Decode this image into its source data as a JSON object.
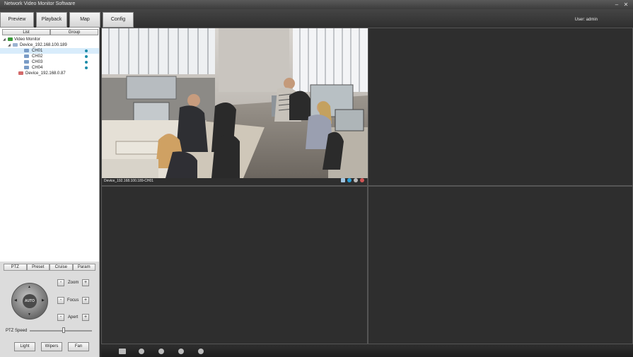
{
  "window": {
    "title": "Network Video Monitor Software"
  },
  "tabs": [
    "Preview",
    "Playback",
    "Map",
    "Config"
  ],
  "user": "User: admin",
  "left": {
    "tabs": [
      "List",
      "Group"
    ],
    "tree": {
      "root": "Video Monitor",
      "device1": "Device_192.168.100.189",
      "channels": [
        "CH01",
        "CH02",
        "CH03",
        "CH04"
      ],
      "device2": "Device_192.168.0.87"
    }
  },
  "ptz": {
    "tabs": [
      "PTZ",
      "Preset",
      "Cruise",
      "Param"
    ],
    "auto": "AUTO",
    "zoom": "Zoom",
    "focus": "Focus",
    "apert": "Apert",
    "speed_label": "PTZ Speed",
    "speed_value": 0.55,
    "buttons": [
      "Light",
      "Wipers",
      "Fan"
    ]
  },
  "video": {
    "label": "Device_192.168.100.189-CH01"
  },
  "icons": [
    "minimize-icon",
    "close-icon",
    "monitor-icon",
    "device-icon",
    "camera-icon",
    "record-icon",
    "snapshot-icon",
    "audio-icon",
    "layout-icon"
  ],
  "colors": {
    "accent": "#1d8ca8",
    "panel": "#dcdcdc",
    "grid": "#2e2e2e"
  }
}
